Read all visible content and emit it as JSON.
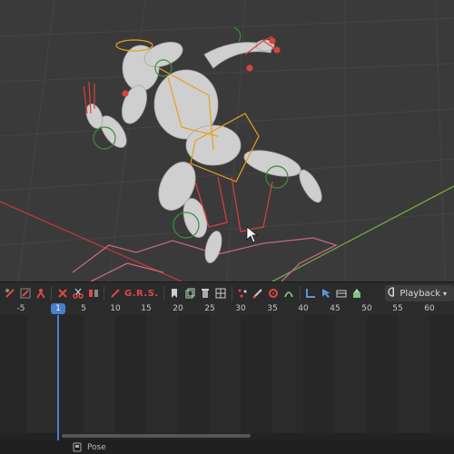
{
  "viewport": {
    "colors": {
      "background": "#3a3a3a",
      "x_axis": "#b83a3a",
      "y_axis": "#7aa63a",
      "bone_orange": "#e6a020",
      "ik_red": "#d9423a",
      "control_green": "#3e8c3c"
    }
  },
  "toolbar": {
    "transform_letters": "G.R.S.",
    "icons": [
      "red-bone-icon",
      "red-bone-icon",
      "red-pose-icon",
      "red-cross-icon",
      "red-scissors-icon",
      "red-flip-icon",
      "red-bone-icon",
      "red-bone-icon",
      "bookmark-icon",
      "copy-icon",
      "delete-icon",
      "grid-icon",
      "scatter-icon",
      "bones-icon",
      "gear-icon",
      "snap-icon",
      "axis-icon",
      "cursor-icon",
      "shelf-icon",
      "mesh-icon"
    ],
    "keying_icon": "keyframe-clock-icon",
    "playback_label": "Playback",
    "playback_arrow": "chevron-down-icon"
  },
  "timeline": {
    "current_frame": "1",
    "ticks": [
      "-5",
      "5",
      "10",
      "15",
      "20",
      "25",
      "30",
      "35",
      "40",
      "45",
      "50",
      "55",
      "60"
    ],
    "accent_color": "#4a7fc9"
  },
  "statusbar": {
    "mode_icon": "pose-mode-icon",
    "mode_label": "Pose"
  }
}
